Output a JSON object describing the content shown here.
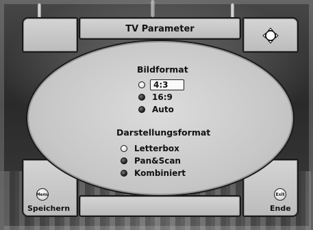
{
  "header": {
    "title": "TV Parameter"
  },
  "picture_format": {
    "heading": "Bildformat",
    "options": [
      {
        "label": "4:3",
        "selected": true
      },
      {
        "label": "16:9",
        "selected": false
      },
      {
        "label": "Auto",
        "selected": false
      }
    ]
  },
  "display_format": {
    "heading": "Darstellungsformat",
    "options": [
      {
        "label": "Letterbox",
        "selected": true
      },
      {
        "label": "Pan&Scan",
        "selected": false
      },
      {
        "label": "Kombiniert",
        "selected": false
      }
    ]
  },
  "footer": {
    "left": {
      "key": "Menu",
      "label": "Speichern"
    },
    "right": {
      "key": "Exit",
      "label": "Ende"
    }
  },
  "icons": {
    "top_right": "move-arrows-icon"
  }
}
